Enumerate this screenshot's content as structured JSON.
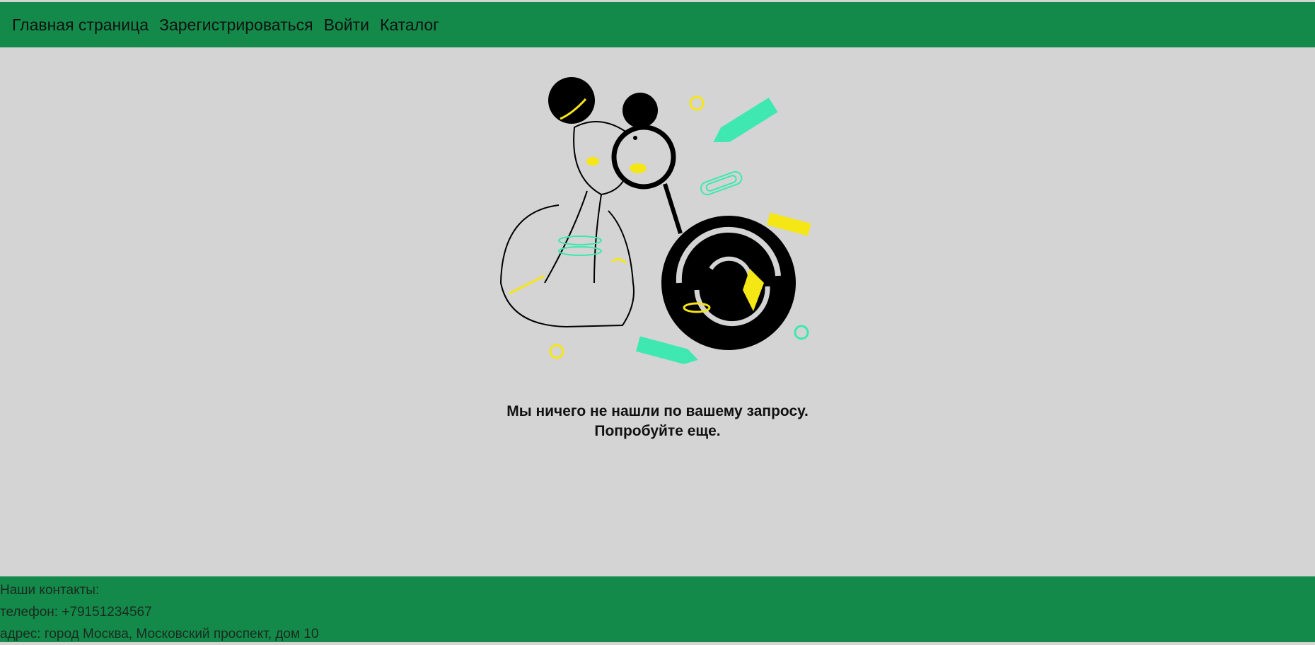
{
  "nav": {
    "home": "Главная страница",
    "register": "Зарегистрироваться",
    "login": "Войти",
    "catalog": "Каталог"
  },
  "message": {
    "line1": "Мы ничего не нашли по вашему запросу.",
    "line2": "Попробуйте еще."
  },
  "footer": {
    "heading": "Наши контакты:",
    "phone": "телефон: +79151234567",
    "address": "адрес: город Москва, Московский проспект, дом 10"
  },
  "colors": {
    "header_bg": "#138a4a",
    "page_bg": "#d4d4d4",
    "accent_mint": "#3ee8b0",
    "accent_yellow": "#f5e615"
  },
  "illustration": {
    "icon": "search-not-found-illustration"
  }
}
